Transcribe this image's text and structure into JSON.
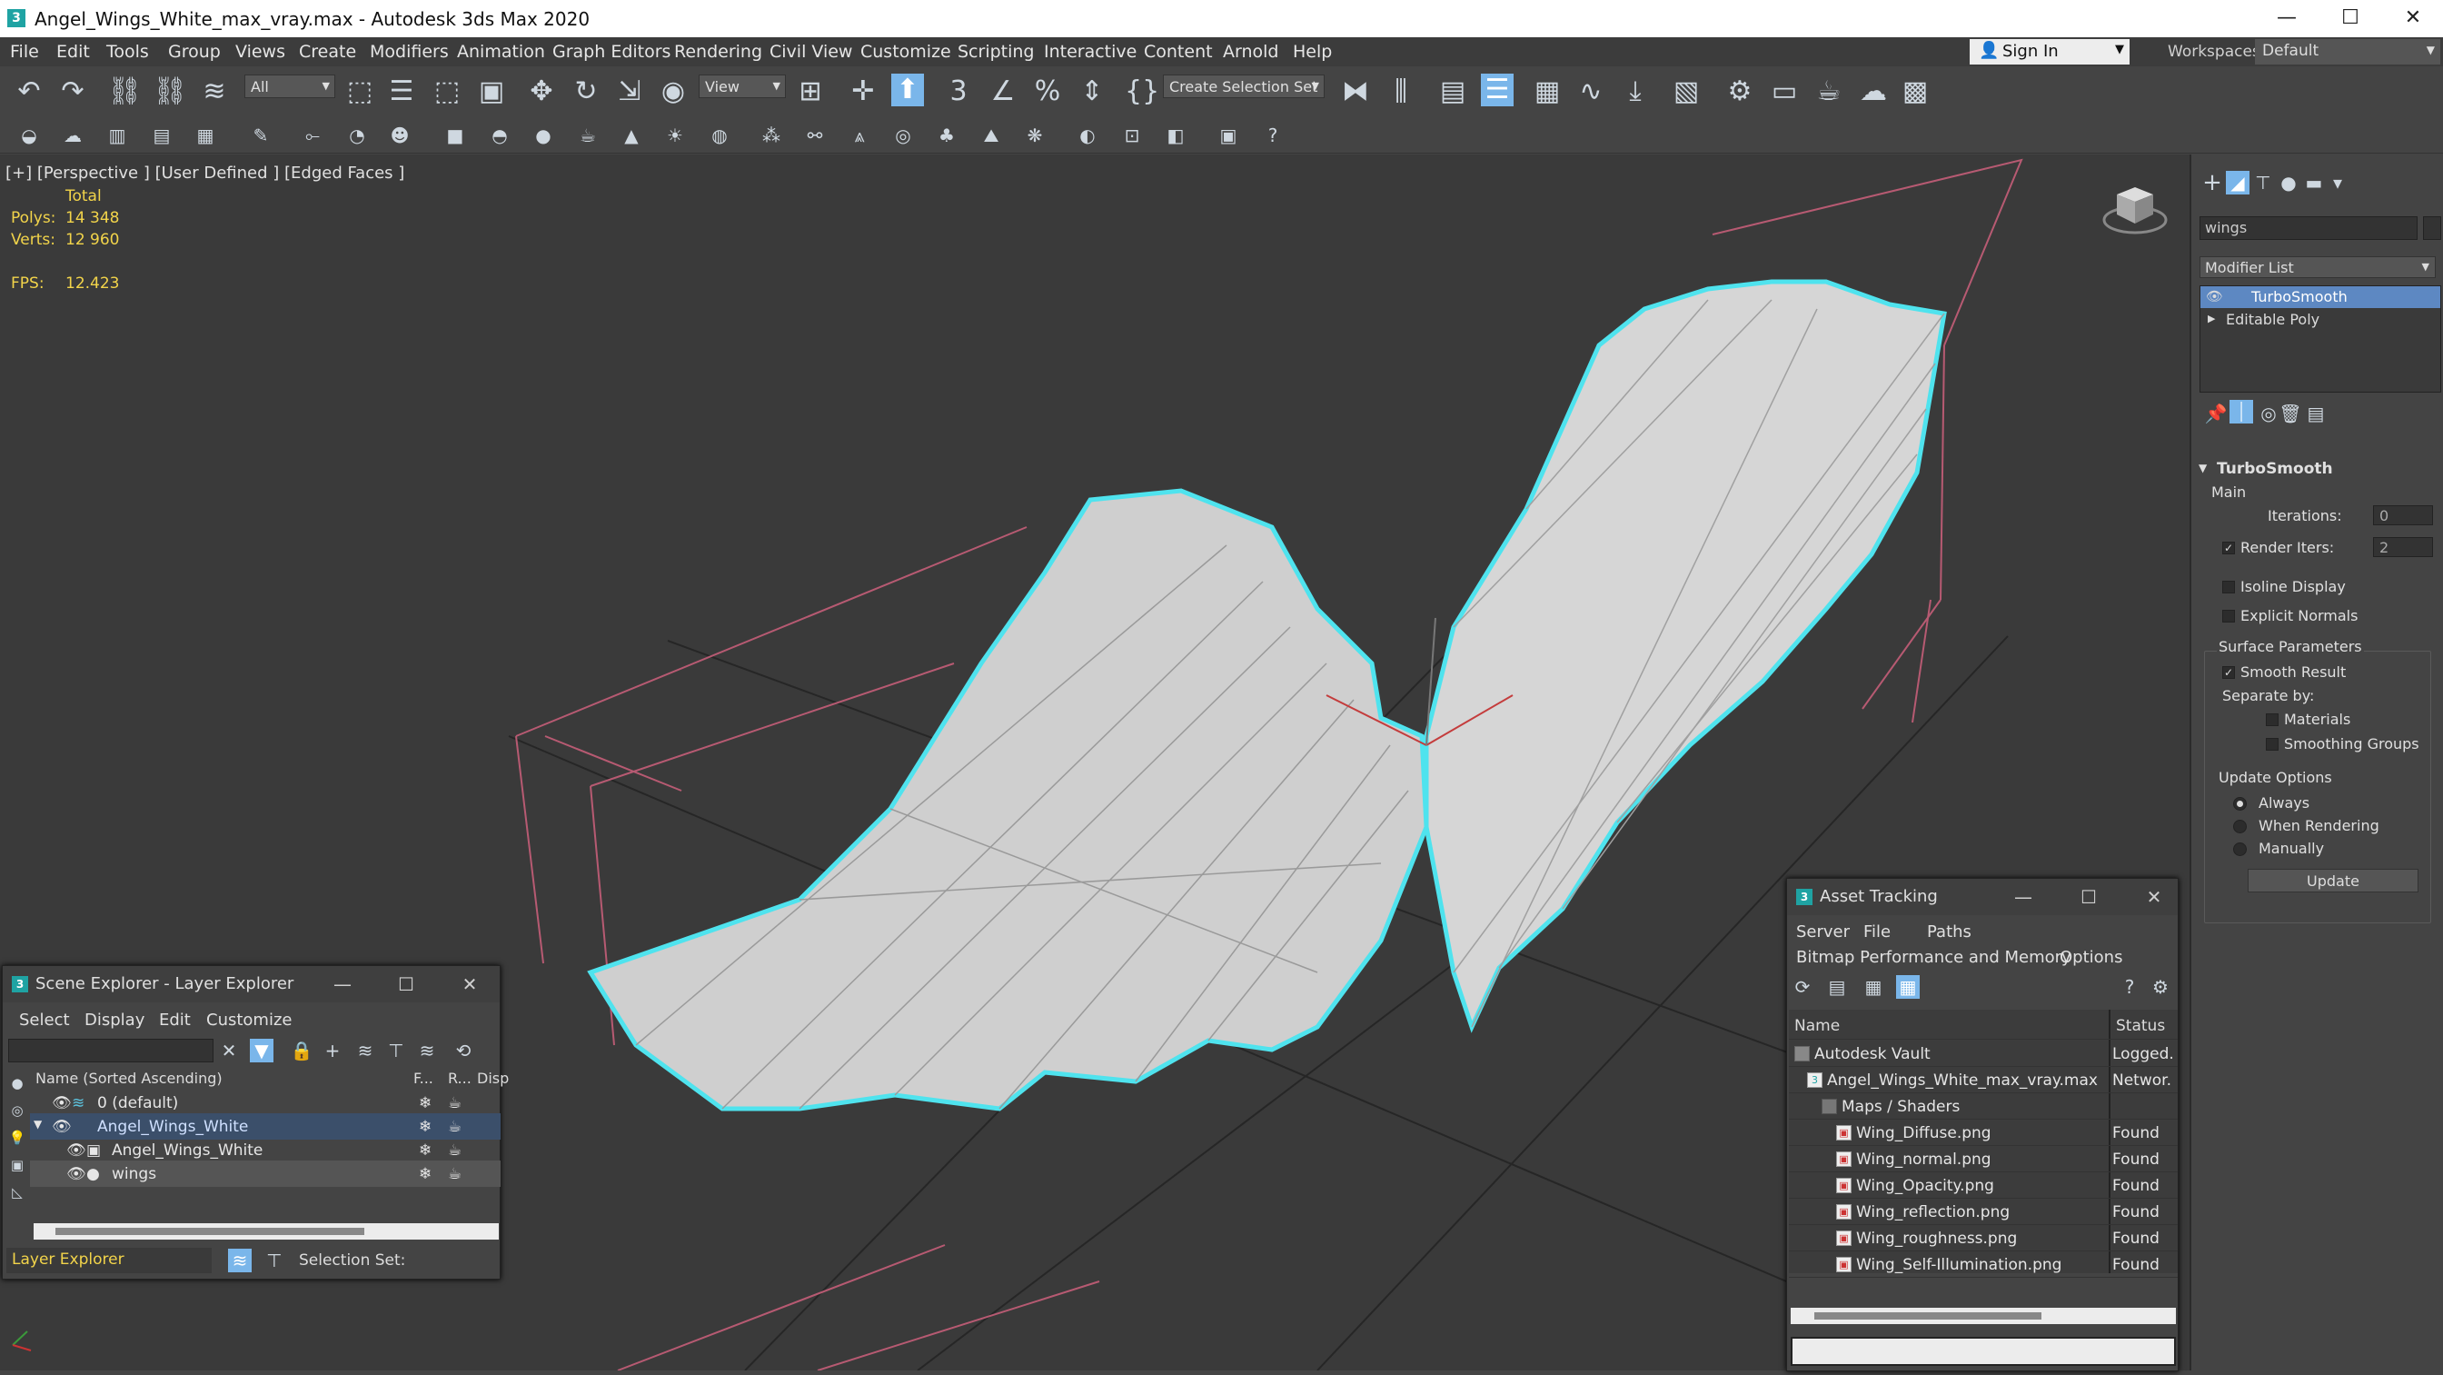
{
  "window": {
    "title": "Angel_Wings_White_max_vray.max - Autodesk 3ds Max 2020",
    "app_icon": "3",
    "minimize": "—",
    "maximize": "☐",
    "close": "✕"
  },
  "menu": [
    "File",
    "Edit",
    "Tools",
    "Group",
    "Views",
    "Create",
    "Modifiers",
    "Animation",
    "Graph Editors",
    "Rendering",
    "Civil View",
    "Customize",
    "Scripting",
    "Interactive",
    "Content",
    "Arnold",
    "Help"
  ],
  "account": {
    "sign_in": "Sign In",
    "workspaces_label": "Workspaces:",
    "workspace": "Default"
  },
  "toolbar": {
    "filter": "All",
    "ref_coord": "View",
    "snap_angle": "3",
    "selection_set_placeholder": "Create Selection Set"
  },
  "viewport": {
    "label": "[+] [Perspective ] [User Defined ] [Edged Faces ]",
    "stats_header": "Total",
    "polys_label": "Polys:",
    "polys_value": "14 348",
    "verts_label": "Verts:",
    "verts_value": "12 960",
    "fps_label": "FPS:",
    "fps_value": "12.423"
  },
  "command_panel": {
    "object_name": "wings",
    "modifier_list": "Modifier List",
    "stack": [
      "TurboSmooth",
      "Editable Poly"
    ],
    "rollout_title": "TurboSmooth",
    "main_label": "Main",
    "iterations_label": "Iterations:",
    "iterations_value": "0",
    "render_iters_label": "Render Iters:",
    "render_iters_value": "2",
    "isoline_display": "Isoline Display",
    "explicit_normals": "Explicit Normals",
    "surface_params_label": "Surface Parameters",
    "smooth_result": "Smooth Result",
    "separate_by": "Separate by:",
    "materials": "Materials",
    "smoothing_groups": "Smoothing Groups",
    "update_options_label": "Update Options",
    "always": "Always",
    "when_rendering": "When Rendering",
    "manually": "Manually",
    "update_button": "Update",
    "checkmark": "✓"
  },
  "scene_explorer": {
    "title": "Scene Explorer - Layer Explorer",
    "menu": [
      "Select",
      "Display",
      "Edit",
      "Customize"
    ],
    "col_name": "Name (Sorted Ascending)",
    "col_f": "F...",
    "col_r": "R...",
    "col_disp": "Disp",
    "rows": [
      "0 (default)",
      "Angel_Wings_White",
      "Angel_Wings_White",
      "wings"
    ],
    "footer_mode": "Layer Explorer",
    "selection_set_label": "Selection Set:"
  },
  "asset_tracking": {
    "title": "Asset Tracking",
    "menu": [
      "Server",
      "File",
      "Paths"
    ],
    "menu2": [
      "Bitmap Performance and Memory",
      "Options"
    ],
    "col_name": "Name",
    "col_status": "Status",
    "rows": [
      {
        "name": "Autodesk Vault",
        "status": "Logged."
      },
      {
        "name": "Angel_Wings_White_max_vray.max",
        "status": "Networ.."
      },
      {
        "name": "Maps / Shaders",
        "status": ""
      },
      {
        "name": "Wing_Diffuse.png",
        "status": "Found"
      },
      {
        "name": "Wing_normal.png",
        "status": "Found"
      },
      {
        "name": "Wing_Opacity.png",
        "status": "Found"
      },
      {
        "name": "Wing_reflection.png",
        "status": "Found"
      },
      {
        "name": "Wing_roughness.png",
        "status": "Found"
      },
      {
        "name": "Wing_Self-Illumination.png",
        "status": "Found"
      }
    ]
  },
  "colors": {
    "selection_outline": "#4fe3ee",
    "accent": "#7ab6ea",
    "stats_yellow": "#f2d44a"
  }
}
